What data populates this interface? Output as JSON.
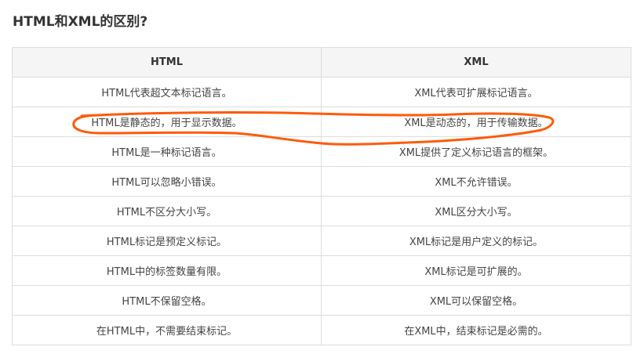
{
  "title": "HTML和XML的区别?",
  "table": {
    "headers": [
      "HTML",
      "XML"
    ],
    "rows": [
      [
        "HTML代表超文本标记语言。",
        "XML代表可扩展标记语言。"
      ],
      [
        "HTML是静态的，用于显示数据。",
        "XML是动态的，用于传输数据。"
      ],
      [
        "HTML是一种标记语言。",
        "XML提供了定义标记语言的框架。"
      ],
      [
        "HTML可以忽略小错误。",
        "XML不允许错误。"
      ],
      [
        "HTML不区分大小写。",
        "XML区分大小写。"
      ],
      [
        "HTML标记是预定义标记。",
        "XML标记是用户定义的标记。"
      ],
      [
        "HTML中的标签数量有限。",
        "XML标记是可扩展的。"
      ],
      [
        "HTML不保留空格。",
        "XML可以保留空格。"
      ],
      [
        "在HTML中，不需要结束标记。",
        "在XML中，结束标记是必需的。"
      ]
    ]
  },
  "colors": {
    "annotation": "#ff5a0a",
    "header_bg": "#f5f5f5",
    "border": "#dddddd"
  }
}
